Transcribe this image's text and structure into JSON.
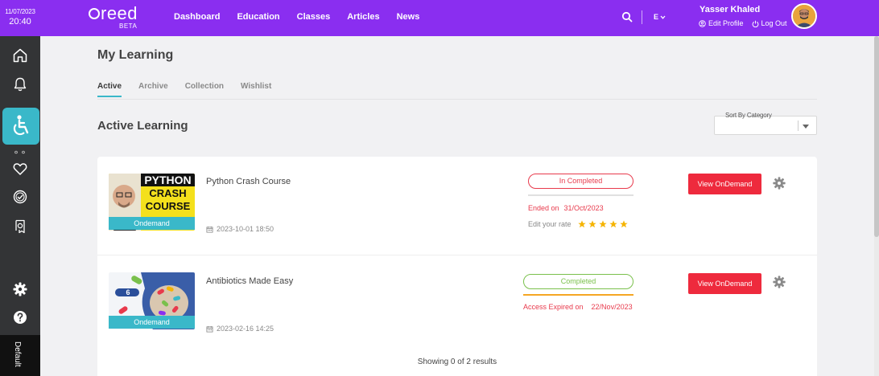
{
  "clock": {
    "date": "11/07/2023",
    "time": "20:40"
  },
  "brand": {
    "name": "reed",
    "badge": "BETA"
  },
  "nav": [
    "Dashboard",
    "Education",
    "Classes",
    "Articles",
    "News"
  ],
  "language": "E",
  "user": {
    "name": "Yasser Khaled",
    "edit_profile": "Edit Profile",
    "logout": "Log Out"
  },
  "sidebar": {
    "icons": [
      "home-icon",
      "bell-icon",
      "accessibility-icon",
      "heart-icon",
      "badge-check-icon",
      "certificate-icon",
      "gear-icon",
      "help-icon"
    ],
    "default_label": "Default"
  },
  "page": {
    "title": "My Learning",
    "tabs": [
      "Active",
      "Archive",
      "Collection",
      "Wishlist"
    ],
    "active_tab": "Active",
    "section_title": "Active Learning",
    "sort_label": "Sort By Category",
    "sort_value": ""
  },
  "courses": [
    {
      "thumb_text": [
        "PYTHON",
        "CRASH",
        "COURSE"
      ],
      "type": "Ondemand",
      "name": "Python Crash Course",
      "date": "2023-10-01 18:50",
      "status": "In Completed",
      "info_label": "Ended on",
      "info_value": "31/Oct/2023",
      "rate_label": "Edit your rate",
      "rating": 5,
      "action": "View OnDemand"
    },
    {
      "thumb_text": [
        "6"
      ],
      "type": "Ondemand",
      "name": "Antibiotics Made Easy",
      "date": "2023-02-16 14:25",
      "status": "Completed",
      "info_label": "Access Expired on",
      "info_value": "22/Nov/2023",
      "action": "View OnDemand"
    }
  ],
  "results_text": "Showing 0 of 2 results",
  "colors": {
    "topbar": "#8a2ef0",
    "accent": "#3ab8c9",
    "danger": "#ee2a3d",
    "success": "#7ac04c",
    "star": "#f5b400"
  }
}
